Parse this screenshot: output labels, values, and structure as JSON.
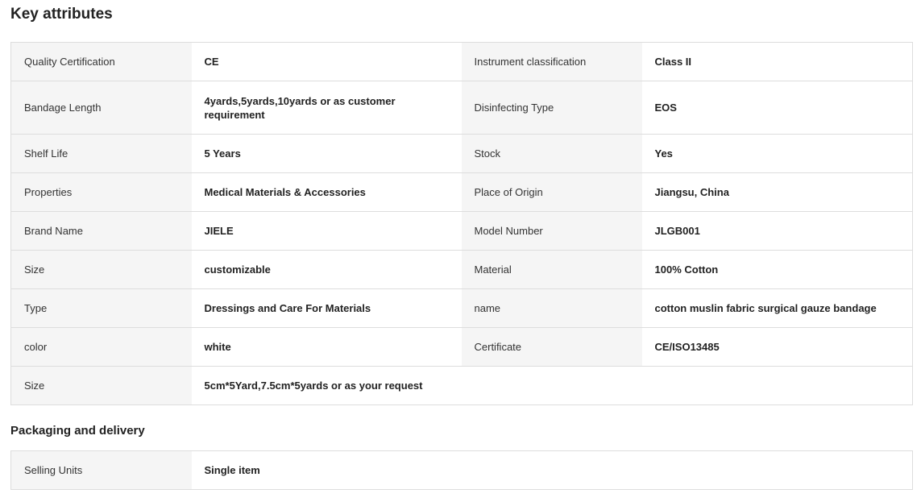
{
  "key_attributes": {
    "title": "Key attributes",
    "rows": [
      {
        "l1": "Quality Certification",
        "v1": "CE",
        "l2": "Instrument classification",
        "v2": "Class II"
      },
      {
        "l1": "Bandage Length",
        "v1": "4yards,5yards,10yards or as customer requirement",
        "l2": "Disinfecting Type",
        "v2": "EOS"
      },
      {
        "l1": "Shelf Life",
        "v1": "5 Years",
        "l2": "Stock",
        "v2": "Yes"
      },
      {
        "l1": "Properties",
        "v1": "Medical Materials & Accessories",
        "l2": "Place of Origin",
        "v2": "Jiangsu, China"
      },
      {
        "l1": "Brand Name",
        "v1": "JIELE",
        "l2": "Model Number",
        "v2": "JLGB001"
      },
      {
        "l1": "Size",
        "v1": "customizable",
        "l2": "Material",
        "v2": "100% Cotton"
      },
      {
        "l1": "Type",
        "v1": "Dressings and Care For Materials",
        "l2": "name",
        "v2": "cotton muslin fabric surgical gauze bandage"
      },
      {
        "l1": "color",
        "v1": "white",
        "l2": "Certificate",
        "v2": "CE/ISO13485"
      }
    ],
    "last_row": {
      "label": "Size",
      "value": "5cm*5Yard,7.5cm*5yards or as your request"
    }
  },
  "packaging": {
    "title": "Packaging and delivery",
    "rows": [
      {
        "label": "Selling Units",
        "value": "Single item"
      }
    ]
  }
}
